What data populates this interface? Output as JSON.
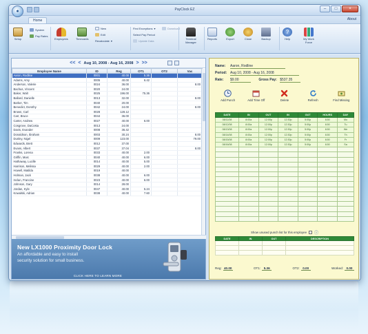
{
  "window": {
    "title": "PayClock EZ"
  },
  "ribbon": {
    "tab": "Home",
    "about": "About",
    "buttons": {
      "setup": "Setup",
      "system": "System",
      "pay_rates": "Pay Rates",
      "employees": "Employees",
      "timecards": "Timecards",
      "new": "New",
      "edit": "Edit",
      "recalculate": "Recalculate",
      "find_exceptions": "Find Exceptions",
      "select_pay_period": "Select Pay Period",
      "update_data": "Update Data",
      "download": "Download",
      "terminal_manager": "Terminal Manager",
      "reports": "Reports",
      "export": "Export",
      "close": "Close",
      "backup": "Backup",
      "help": "Help",
      "my_work_force": "My Work Force"
    }
  },
  "date_nav": {
    "range": "Aug 10, 2008 - Aug 16, 2008",
    "first": "<<",
    "prev": "<",
    "next": ">",
    "last": ">>"
  },
  "employee_table": {
    "columns": [
      "Employee Name",
      "ID",
      "Reg",
      "OT1",
      "OT2",
      "Vac"
    ],
    "selected_index": 0,
    "rows": [
      [
        "Aaron, Rodline",
        "0001",
        "40.00",
        "5.36",
        "",
        ""
      ],
      [
        "Adams, Amy",
        "0005",
        "40.00",
        "6.42",
        "",
        ""
      ],
      [
        "Anderson, Valerie",
        "0024",
        "36.00",
        "",
        "",
        "8.00"
      ],
      [
        "Bachus, Vincent",
        "0020",
        "24.00",
        "",
        "",
        ""
      ],
      [
        "Baker, Walt",
        "0025",
        "196.00",
        "75.36",
        "",
        ""
      ],
      [
        "Ballard, Danielle",
        "0013",
        "32.00",
        "",
        "",
        "8.00"
      ],
      [
        "Barker, Tim",
        "0040",
        "20.00",
        "",
        "",
        ""
      ],
      [
        "Benedict, Dorothy",
        "0042",
        "24.00",
        "",
        "",
        "8.00"
      ],
      [
        "Brown, Carl",
        "0028",
        "128.12",
        "",
        "",
        ""
      ],
      [
        "Carr, Bruce",
        "0044",
        "36.00",
        "",
        "",
        ""
      ],
      [
        "Carter, Andrew",
        "0027",
        "40.00",
        "6.00",
        "",
        ""
      ],
      [
        "Cosgrove, DaCosta",
        "0013",
        "24.00",
        "",
        "",
        ""
      ],
      [
        "Davis, Evander",
        "0008",
        "36.42",
        "",
        "",
        ""
      ],
      [
        "Donaldson, Ibraham",
        "0003",
        "30.24",
        "",
        "",
        "8.00"
      ],
      [
        "Dunley, Nigel",
        "0009",
        "123.00",
        "",
        "",
        "79.00"
      ],
      [
        "Edwards, Brett",
        "0012",
        "37.00",
        "",
        "",
        ""
      ],
      [
        "Evans, Albert",
        "0037",
        "37.04",
        "",
        "",
        "8.00"
      ],
      [
        "Franks, Lorena",
        "0033",
        "40.00",
        "2.00",
        "",
        ""
      ],
      [
        "Griffin, Marc",
        "0040",
        "40.00",
        "6.00",
        "",
        ""
      ],
      [
        "Hathaway, Lucille",
        "0014",
        "40.00",
        "5.00",
        "",
        ""
      ],
      [
        "Harrison, Melissa",
        "0029",
        "40.00",
        "2.00",
        "",
        ""
      ],
      [
        "Howell, Matilda",
        "0019",
        "40.00",
        "",
        "",
        ""
      ],
      [
        "Holman, Jack",
        "0038",
        "40.00",
        "6.00",
        "",
        ""
      ],
      [
        "Inclan, Francine",
        "0023",
        "40.00",
        "6.00",
        "",
        ""
      ],
      [
        "Johnson, Gary",
        "0014",
        "28.00",
        "",
        "",
        ""
      ],
      [
        "Jordan, Kyle",
        "0047",
        "40.00",
        "5.24",
        "",
        ""
      ],
      [
        "Kowalski, Adrian",
        "0038",
        "40.00",
        "7.60",
        "",
        ""
      ]
    ]
  },
  "ad": {
    "title": "New LX1000 Proximity Door Lock",
    "line1": "An affordable and easy to install",
    "line2": "security solution for small business.",
    "cta": "CLICK HERE TO LEARN MORE"
  },
  "detail": {
    "name_label": "Name:",
    "name": "Aaron, Rodline",
    "period_label": "Period:",
    "period": "Aug 10, 2008 - Aug 16, 2008",
    "rate_label": "Rate:",
    "rate": "$9.00",
    "gross_label": "Gross Pay:",
    "gross": "$537.35",
    "actions": [
      "Add Punch",
      "Add Time Off",
      "Delete",
      "Refresh",
      "Find Missing"
    ],
    "punch_columns": [
      "DATE",
      "IN",
      "OUT",
      "IN",
      "OUT",
      "HOURS",
      "DAY"
    ],
    "punch_rows": [
      [
        "08/11/08",
        "8:00a",
        "12:00p",
        "12:30p",
        "5:00p",
        "8.50",
        "Mo"
      ],
      [
        "08/12/08",
        "8:00a",
        "12:00p",
        "12:30p",
        "5:00p",
        "8.50",
        "Tu"
      ],
      [
        "08/13/08",
        "8:00a",
        "12:00p",
        "12:30p",
        "5:00p",
        "8.50",
        "We"
      ],
      [
        "08/14/08",
        "8:00a",
        "12:00p",
        "12:30p",
        "5:00p",
        "8.50",
        "Th"
      ],
      [
        "08/15/08",
        "8:00a",
        "12:00p",
        "12:30p",
        "5:00p",
        "8.50",
        "Fr"
      ],
      [
        "08/16/08",
        "8:00a",
        "12:00p",
        "12:30p",
        "5:00p",
        "8.50",
        "Sa"
      ]
    ],
    "empty_rows": 15,
    "unused_label": "Show unused punch list for this employee",
    "unused_columns": [
      "DATE",
      "IN",
      "OUT",
      "DESCRIPTION"
    ],
    "totals": {
      "reg_label": "Reg:",
      "reg": "40.00",
      "ot1_label": "OT1:",
      "ot1": "5.36",
      "ot2_label": "OT2:",
      "ot2": "0.00",
      "worked_label": "Worked:",
      "worked": "0.00"
    }
  },
  "colors": {
    "accent": "#3f6ec2",
    "punch_header": "#2f8a38",
    "detail_bg": "#fbf9cf",
    "ad_bg": "#4b79ac"
  }
}
